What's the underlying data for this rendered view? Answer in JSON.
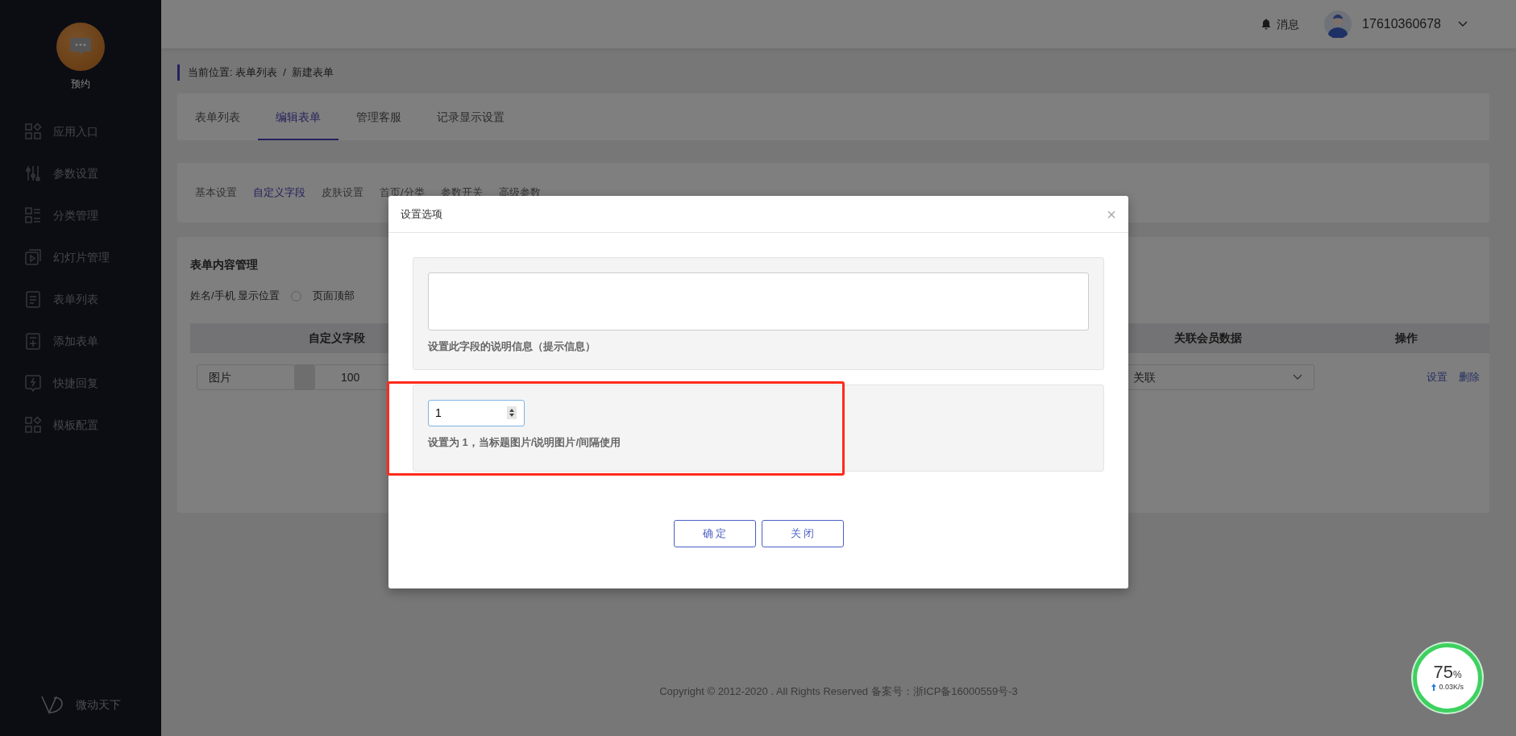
{
  "sidebar": {
    "logo_label": "预约",
    "items": [
      {
        "label": "应用入口",
        "kind": "apps"
      },
      {
        "label": "参数设置",
        "kind": "sliders"
      },
      {
        "label": "分类管理",
        "kind": "list"
      },
      {
        "label": "幻灯片管理",
        "kind": "slides"
      },
      {
        "label": "表单列表",
        "kind": "document"
      },
      {
        "label": "添加表单",
        "kind": "add"
      },
      {
        "label": "快捷回复",
        "kind": "reply"
      },
      {
        "label": "模板配置",
        "kind": "apps"
      }
    ],
    "brand": "微动天下"
  },
  "header": {
    "notifications": "消息",
    "user": "17610360678"
  },
  "breadcrumb": {
    "prefix": "当前位置:",
    "items": [
      "表单列表",
      "新建表单"
    ],
    "separator": "/"
  },
  "tabs": [
    {
      "label": "表单列表",
      "selected": false
    },
    {
      "label": "编辑表单",
      "selected": true
    },
    {
      "label": "管理客服",
      "selected": false
    },
    {
      "label": "记录显示设置",
      "selected": false
    }
  ],
  "subtabs": [
    {
      "label": "基本设置",
      "selected": false
    },
    {
      "label": "自定义字段",
      "selected": true
    },
    {
      "label": "皮肤设置",
      "selected": false
    },
    {
      "label": "首页/分类",
      "selected": false
    },
    {
      "label": "参数开关",
      "selected": false
    },
    {
      "label": "高级参数",
      "selected": false
    }
  ],
  "content": {
    "title": "表单内容管理",
    "display_option": {
      "label": "姓名/手机 显示位置",
      "radio_label": "页面顶部",
      "checked": false
    },
    "table": {
      "columns": [
        {
          "label": "自定义字段"
        },
        {
          "label": "关联会员数据"
        },
        {
          "label": "操作"
        }
      ],
      "rows": [
        {
          "field_name": "图片",
          "size": "100",
          "member_link": "关联",
          "actions": [
            "设置",
            "删除"
          ]
        }
      ]
    }
  },
  "footer": "Copyright © 2012-2020 . All Rights Reserved 备案号：浙ICP备16000559号-3",
  "modal": {
    "title": "设置选项",
    "close": "×",
    "description_hint": "设置此字段的说明信息（提示信息）",
    "number_value": "1",
    "number_hint": "设置为 1，当标题图片/说明图片/间隔使用",
    "buttons": [
      "确 定",
      "关 闭"
    ]
  },
  "speed_widget": {
    "percent": "75",
    "unit": "%",
    "rate": "0.03K/s"
  }
}
